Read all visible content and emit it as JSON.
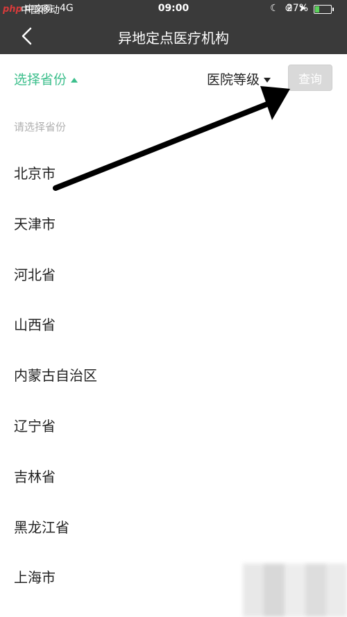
{
  "status_bar": {
    "carrier": "中国移动",
    "network": "4G",
    "time": "09:00",
    "battery": "27%",
    "battery_level": 0.27
  },
  "watermark": {
    "brand": "php",
    "text": "中文网"
  },
  "nav": {
    "title": "异地定点医疗机构"
  },
  "filters": {
    "province_label": "选择省份",
    "grade_label": "医院等级",
    "query_label": "查询"
  },
  "hint": "请选择省份",
  "provinces": [
    "北京市",
    "天津市",
    "河北省",
    "山西省",
    "内蒙古自治区",
    "辽宁省",
    "吉林省",
    "黑龙江省",
    "上海市"
  ],
  "colors": {
    "accent": "#3cbf8c",
    "header_bg": "#3a3a3a",
    "button_disabled": "#d9d9d9"
  }
}
